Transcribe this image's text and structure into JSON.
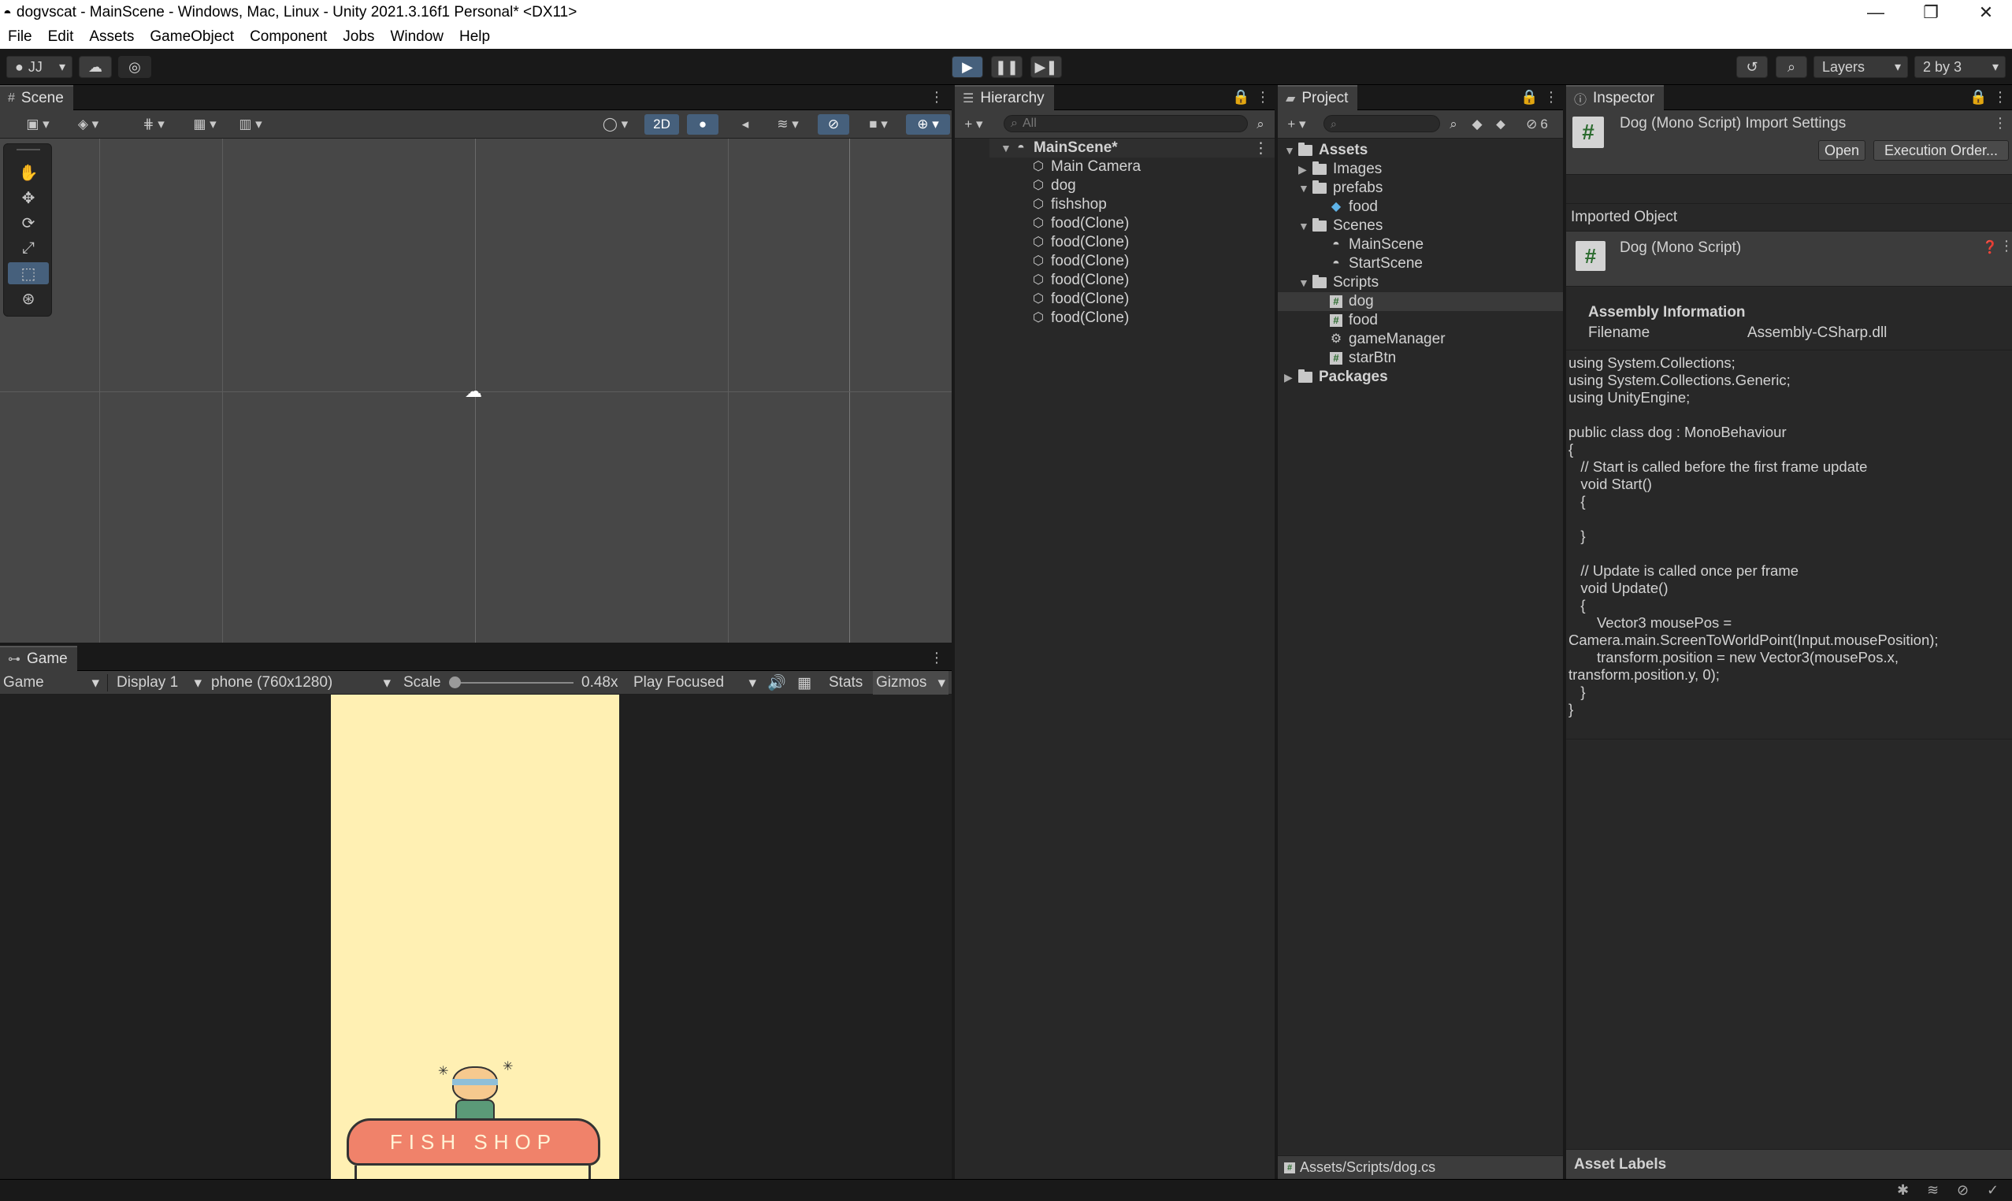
{
  "window": {
    "title": "dogvscat - MainScene - Windows, Mac, Linux - Unity 2021.3.16f1 Personal* <DX11>",
    "minimize": "—",
    "maximize": "❐",
    "close": "✕"
  },
  "menu": [
    "File",
    "Edit",
    "Assets",
    "GameObject",
    "Component",
    "Jobs",
    "Window",
    "Help"
  ],
  "toolbar": {
    "account": "JJ",
    "play": "▶",
    "pause": "❚❚",
    "step": "▶❚",
    "layers": "Layers",
    "layout": "2 by 3"
  },
  "scene": {
    "tab": "Scene",
    "mode2d": "2D"
  },
  "game": {
    "tab": "Game",
    "view": "Game",
    "display": "Display 1",
    "resolution": "phone (760x1280)",
    "scale_label": "Scale",
    "scale_value": "0.48x",
    "play_mode": "Play Focused",
    "stats": "Stats",
    "gizmos": "Gizmos",
    "sign_text": "FISH SHOP"
  },
  "hierarchy": {
    "tab": "Hierarchy",
    "search_placeholder": "All",
    "scene": "MainScene*",
    "items": [
      "Main Camera",
      "dog",
      "fishshop",
      "food(Clone)",
      "food(Clone)",
      "food(Clone)",
      "food(Clone)",
      "food(Clone)",
      "food(Clone)"
    ]
  },
  "project": {
    "tab": "Project",
    "hidden_count": "6",
    "assets": "Assets",
    "images": "Images",
    "prefabs": "prefabs",
    "food_prefab": "food",
    "scenes": "Scenes",
    "scene_main": "MainScene",
    "scene_start": "StartScene",
    "scripts": "Scripts",
    "script_dog": "dog",
    "script_food": "food",
    "script_gm": "gameManager",
    "script_star": "starBtn",
    "packages": "Packages",
    "path": "Assets/Scripts/dog.cs"
  },
  "inspector": {
    "tab": "Inspector",
    "header": "Dog (Mono Script) Import Settings",
    "open": "Open",
    "execution_order": "Execution Order...",
    "imported_object": "Imported Object",
    "object_name": "Dog (Mono Script)",
    "assembly_info": "Assembly Information",
    "filename_label": "Filename",
    "filename_value": "Assembly-CSharp.dll",
    "code": "using System.Collections;\nusing System.Collections.Generic;\nusing UnityEngine;\n\npublic class dog : MonoBehaviour\n{\n   // Start is called before the first frame update\n   void Start()\n   {\n\n   }\n\n   // Update is called once per frame\n   void Update()\n   {\n       Vector3 mousePos =\nCamera.main.ScreenToWorldPoint(Input.mousePosition);\n       transform.position = new Vector3(mousePos.x,\ntransform.position.y, 0);\n   }\n}",
    "asset_labels": "Asset Labels"
  },
  "colors": {
    "accent": "#46607c",
    "game_bg": "#fff0b3",
    "sign": "#f0826a"
  }
}
